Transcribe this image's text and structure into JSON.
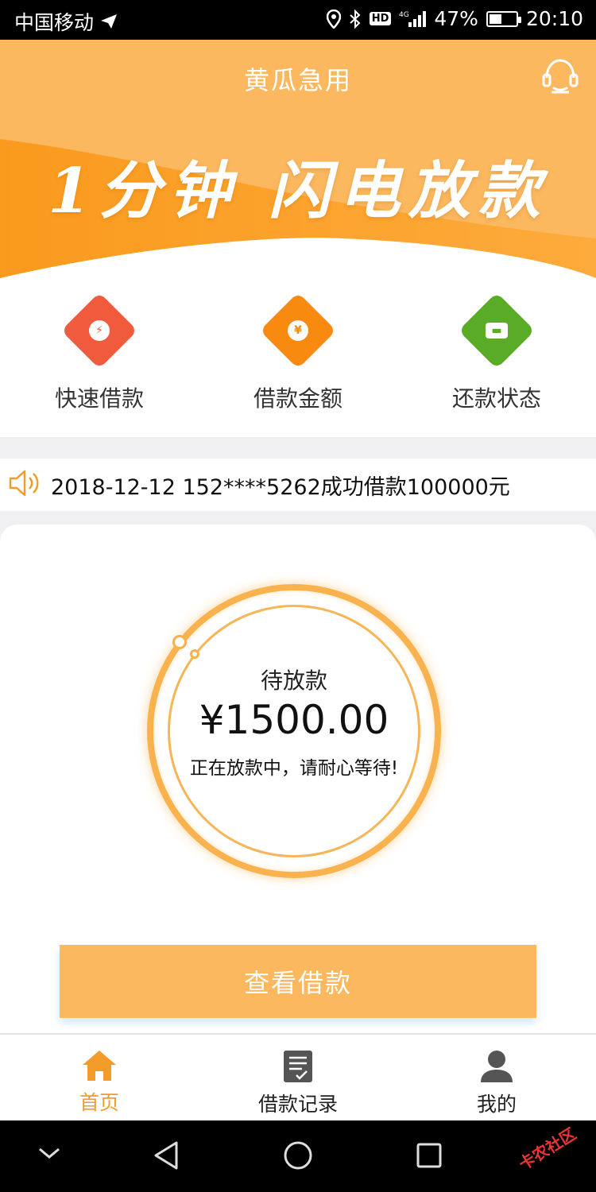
{
  "status_bar": {
    "carrier": "中国移动",
    "network": "4G",
    "hd": "HD",
    "battery_percent": "47%",
    "battery_level": 0.47,
    "time": "20:10"
  },
  "header": {
    "title": "黄瓜急用",
    "slogan": "1分钟 闪电放款",
    "support_icon": "headset-icon"
  },
  "quick_actions": [
    {
      "label": "快速借款",
      "icon": "lightning-icon",
      "color": "#f05a3d"
    },
    {
      "label": "借款金额",
      "icon": "yen-diamond-icon",
      "color": "#f98a10"
    },
    {
      "label": "还款状态",
      "icon": "card-icon",
      "color": "#5aab25"
    }
  ],
  "notice": {
    "icon": "speaker-icon",
    "text": "2018-12-12 152****5262成功借款100000元"
  },
  "loan_status": {
    "status": "待放款",
    "amount": "¥1500.00",
    "tip": "正在放款中，请耐心等待!"
  },
  "primary_button": "查看借款",
  "tabbar": [
    {
      "label": "首页",
      "icon": "home-icon",
      "active": true
    },
    {
      "label": "借款记录",
      "icon": "record-icon",
      "active": false
    },
    {
      "label": "我的",
      "icon": "user-icon",
      "active": false
    }
  ],
  "colors": {
    "accent": "#fbb85f",
    "accent_dark": "#f9931c",
    "active_tab": "#f39c2a",
    "ring": "#f9b24d"
  },
  "watermark": "卡农社区"
}
